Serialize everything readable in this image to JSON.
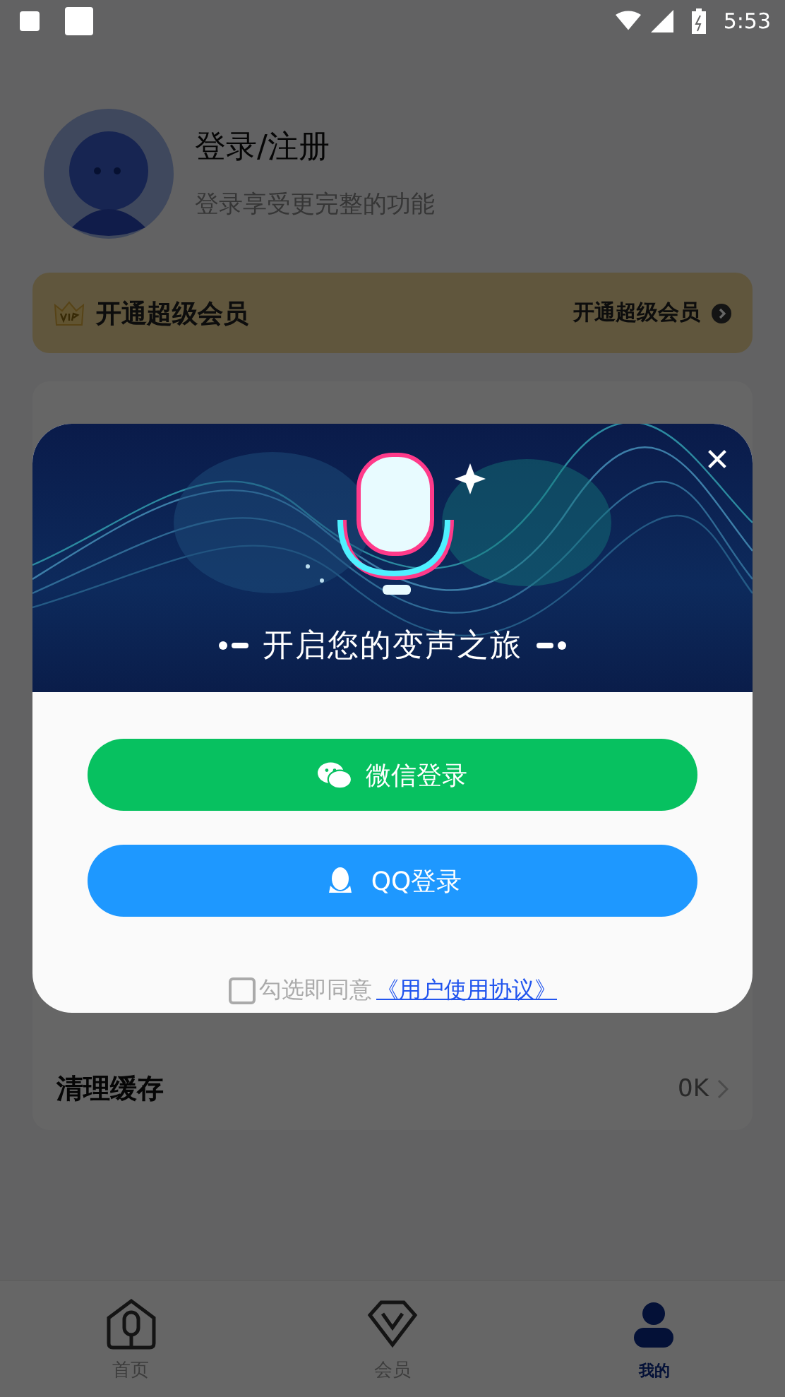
{
  "status_bar": {
    "time": "5:53"
  },
  "profile": {
    "title": "登录/注册",
    "subtitle": "登录享受更完整的功能"
  },
  "vip_banner": {
    "title": "开通超级会员",
    "action": "开通超级会员"
  },
  "settings": [
    {
      "label": "清理缓存",
      "value": "0K"
    }
  ],
  "login_dialog": {
    "headline": "开启您的变声之旅",
    "buttons": [
      {
        "kind": "wechat",
        "label": "微信登录"
      },
      {
        "kind": "qq",
        "label": "QQ登录"
      }
    ],
    "agreement": {
      "checked": false,
      "text": "勾选即同意",
      "link": "《用户使用协议》"
    }
  },
  "tab_bar": [
    {
      "label": "首页",
      "selected": false
    },
    {
      "label": "会员",
      "selected": false
    },
    {
      "label": "我的",
      "selected": true
    }
  ]
}
